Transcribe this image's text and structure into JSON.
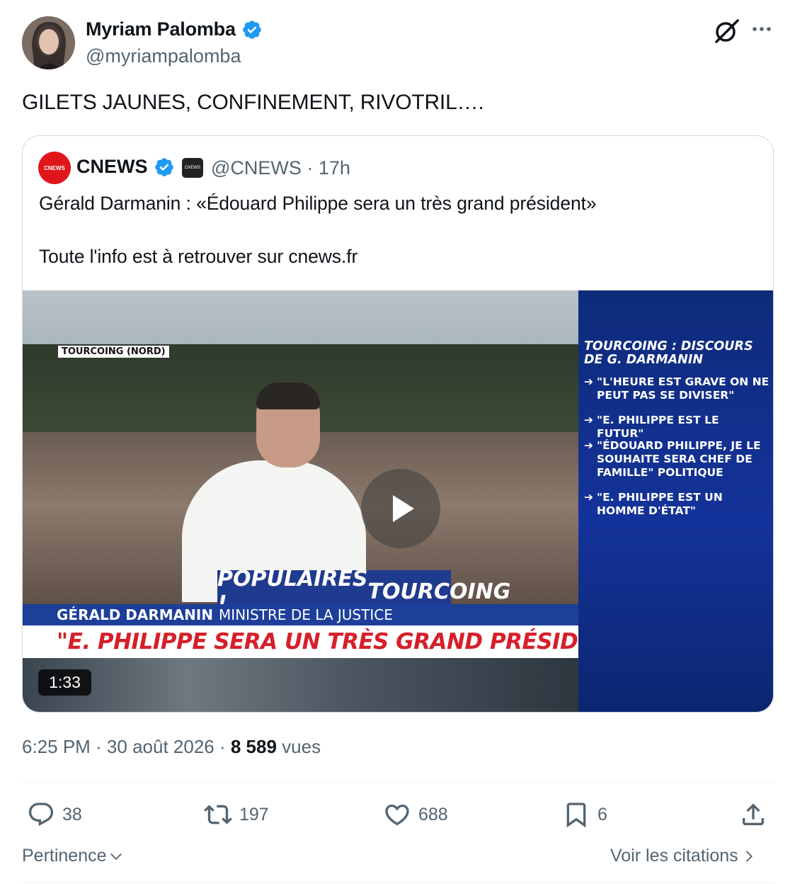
{
  "author": {
    "name": "Myriam Palomba",
    "handle": "@myriampalomba",
    "verified": true
  },
  "tweet_text": "GILETS JAUNES, CONFINEMENT, RIVOTRIL….",
  "quoted": {
    "logo_text": "CNEWS",
    "name": "CNEWS",
    "affiliate_badge_text": "CNEWS",
    "meta": "@CNEWS · 17h",
    "text_line1": "Gérald Darmanin : «Édouard Philippe sera un très grand président»",
    "text_line2": "Toute l'info est à retrouver sur cnews.fr",
    "video": {
      "location_tag": "TOURCOING (NORD)",
      "podium_text_left": "POPULAIRES !",
      "podium_text_right": "TOURCOING",
      "lower_name": "GÉRALD DARMANIN",
      "lower_role": "MINISTRE DE LA JUSTICE",
      "headline": "\"E. PHILIPPE SERA UN TRÈS GRAND PRÉSIDENT\"",
      "duration": "1:33",
      "side_title": "TOURCOING : DISCOURS DE G. DARMANIN",
      "side_items": [
        "\"L'HEURE EST GRAVE ON NE PEUT PAS SE DIVISER\"",
        "\"E. PHILIPPE EST LE FUTUR\"",
        "\"ÉDOUARD PHILIPPE, JE LE SOUHAITE SERA CHEF DE FAMILLE\" POLITIQUE",
        "\"E. PHILIPPE EST UN HOMME D'ÉTAT\""
      ]
    }
  },
  "post_meta": {
    "time_date": "6:25 PM · 30 août 2026 · ",
    "views_count": "8 589",
    "views_label": " vues"
  },
  "actions": {
    "replies": "38",
    "reposts": "197",
    "likes": "688",
    "bookmarks": "6"
  },
  "sort_label": "Pertinence",
  "quotes_link": "Voir les citations",
  "colors": {
    "verified": "#1d9bf0",
    "muted_text": "#536471",
    "cnews_red": "#e1161d"
  }
}
